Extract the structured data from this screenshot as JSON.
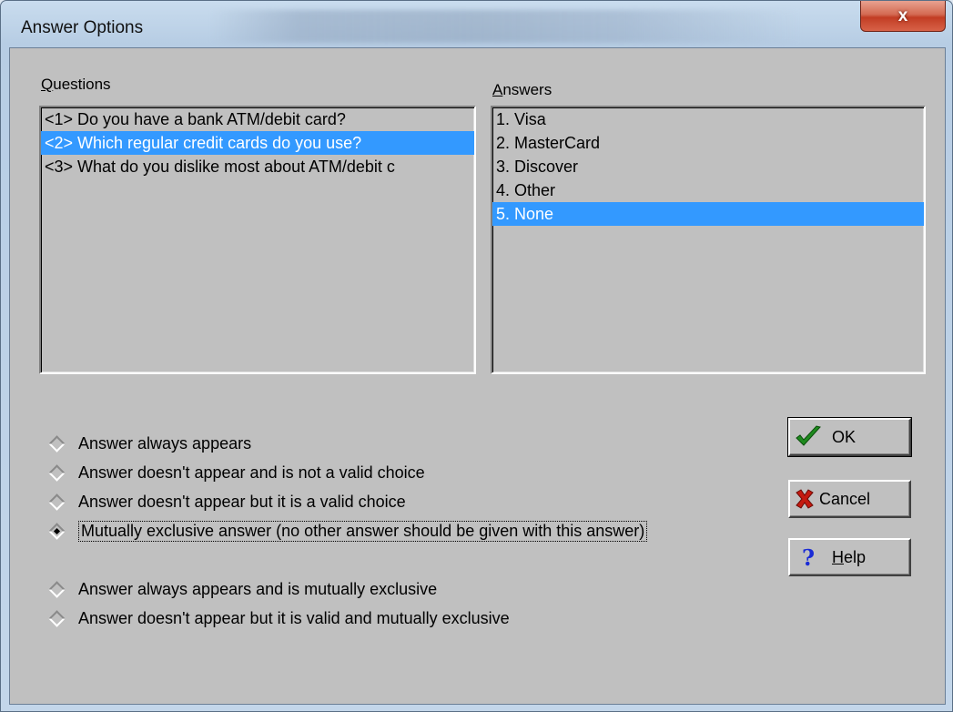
{
  "window": {
    "title": "Answer Options",
    "close_glyph": "x"
  },
  "questions": {
    "label": "Questions",
    "items": [
      {
        "text": "<1>  Do you have a bank ATM/debit card?",
        "selected": false
      },
      {
        "text": "<2>  Which regular credit cards do you use?",
        "selected": true
      },
      {
        "text": "<3>  What do you dislike most about ATM/debit c",
        "selected": false
      }
    ]
  },
  "answers": {
    "label": "Answers",
    "items": [
      {
        "text": "1. Visa",
        "selected": false
      },
      {
        "text": "2. MasterCard",
        "selected": false
      },
      {
        "text": "3. Discover",
        "selected": false
      },
      {
        "text": "4. Other",
        "selected": false
      },
      {
        "text": "5. None",
        "selected": true
      }
    ]
  },
  "options": [
    {
      "label": "Answer always appears",
      "checked": false
    },
    {
      "label": "Answer doesn't appear and is not a valid choice",
      "checked": false
    },
    {
      "label": "Answer doesn't appear but it is a valid choice",
      "checked": false
    },
    {
      "label": "Mutually exclusive answer (no other answer should be given with this answer)",
      "checked": true
    },
    {
      "label": "Answer always appears and is mutually exclusive",
      "checked": false
    },
    {
      "label": "Answer doesn't appear but it is valid and mutually exclusive",
      "checked": false
    }
  ],
  "buttons": {
    "ok": {
      "label": "OK",
      "icon": "check-icon"
    },
    "cancel": {
      "label": "Cancel",
      "icon": "x-icon"
    },
    "help": {
      "label": "Help",
      "icon": "question-icon"
    }
  },
  "colors": {
    "selection": "#3399ff",
    "dialog_face": "#c0c0c0",
    "close_button": "#c94a30"
  }
}
